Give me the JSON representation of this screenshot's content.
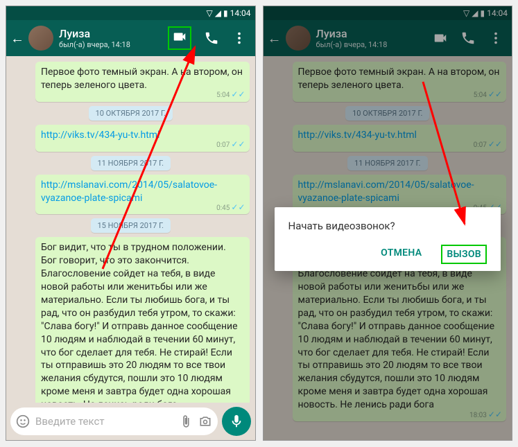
{
  "statusbar": {
    "time": "14:04"
  },
  "header": {
    "contact_name": "Луиза",
    "status": "был(-а) вчера, 14:18"
  },
  "messages": {
    "m1": "Первое фото темный экран. А на втором, он теперь зеленого цвета.",
    "m1_time": "5:04",
    "date1": "10 ОКТЯБРЯ 2017 Г.",
    "m2": "http://viks.tv/434-yu-tv.html",
    "m2_time": "0:07",
    "date2": "11 НОЯБРЯ 2017 Г.",
    "m3": "http://mslanavi.com/2014/05/salatovoe-vyazanoe-plate-spicami",
    "m3_time": "0:45",
    "date3": "15 НОЯБРЯ 2017 Г.",
    "m4": "Бог видит, что ты в трудном положении. Бог говорит, что это закончится. Благословение сойдет на тебя, в виде новой работы или женитьбы или же материально. Если ты любишь бога, и ты рад, что он разбудил тебя утром, то скажи: \"Слава богу!\" И отправь данное сообщение 10 людям и наблюдай в течении 60 минут, что бог сделает для тебя. Не стирай! Если ты отправишь это 20 людям то все твои желания сбудутся, пошли это 10 людям кроме меня и завтра будет одна хорошая новость. Не ленись ради бога",
    "m4_time": "18:03"
  },
  "input": {
    "placeholder": "Введите текст"
  },
  "dialog": {
    "title": "Начать видеозвонок?",
    "cancel": "ОТМЕНА",
    "call": "ВЫЗОВ"
  }
}
